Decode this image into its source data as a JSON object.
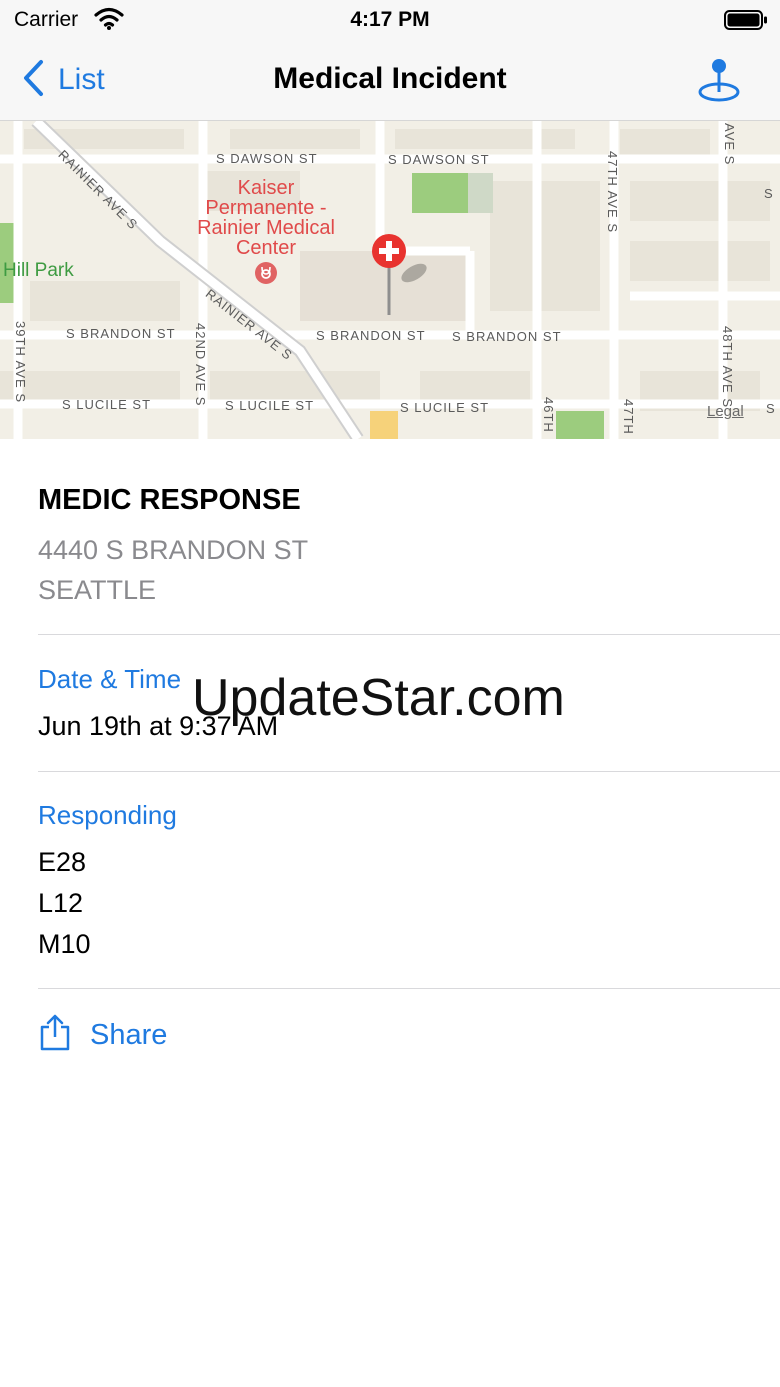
{
  "status_bar": {
    "carrier": "Carrier",
    "time": "4:17 PM"
  },
  "nav": {
    "back_label": "List",
    "title": "Medical Incident"
  },
  "map": {
    "street_labels": [
      "S DAWSON ST",
      "S DAWSON ST",
      "RAINIER AVE S",
      "RAINIER AVE S",
      "S BRANDON ST",
      "S BRANDON ST",
      "S BRANDON ST",
      "S LUCILE ST",
      "S LUCILE ST",
      "S LUCILE ST",
      "39TH AVE S",
      "42ND AVE S",
      "46TH",
      "47TH AVE S",
      "47TH",
      "48TH AVE S",
      "AVE S",
      "S",
      "S"
    ],
    "poi_name": "Kaiser Permanente - Rainier Medical Center",
    "park_name": "Hill Park",
    "legal": "Legal"
  },
  "incident": {
    "type": "MEDIC RESPONSE",
    "address_line1": "4440 S BRANDON ST",
    "address_line2": "SEATTLE"
  },
  "date_time": {
    "label": "Date & Time",
    "value": "Jun 19th at 9:37 AM"
  },
  "responding": {
    "label": "Responding",
    "units": [
      "E28",
      "L12",
      "M10"
    ]
  },
  "share": {
    "label": "Share"
  },
  "watermark": "UpdateStar.com",
  "colors": {
    "accent": "#1f7ae0",
    "poi": "#e04a4a",
    "park": "#9ccc7e"
  }
}
